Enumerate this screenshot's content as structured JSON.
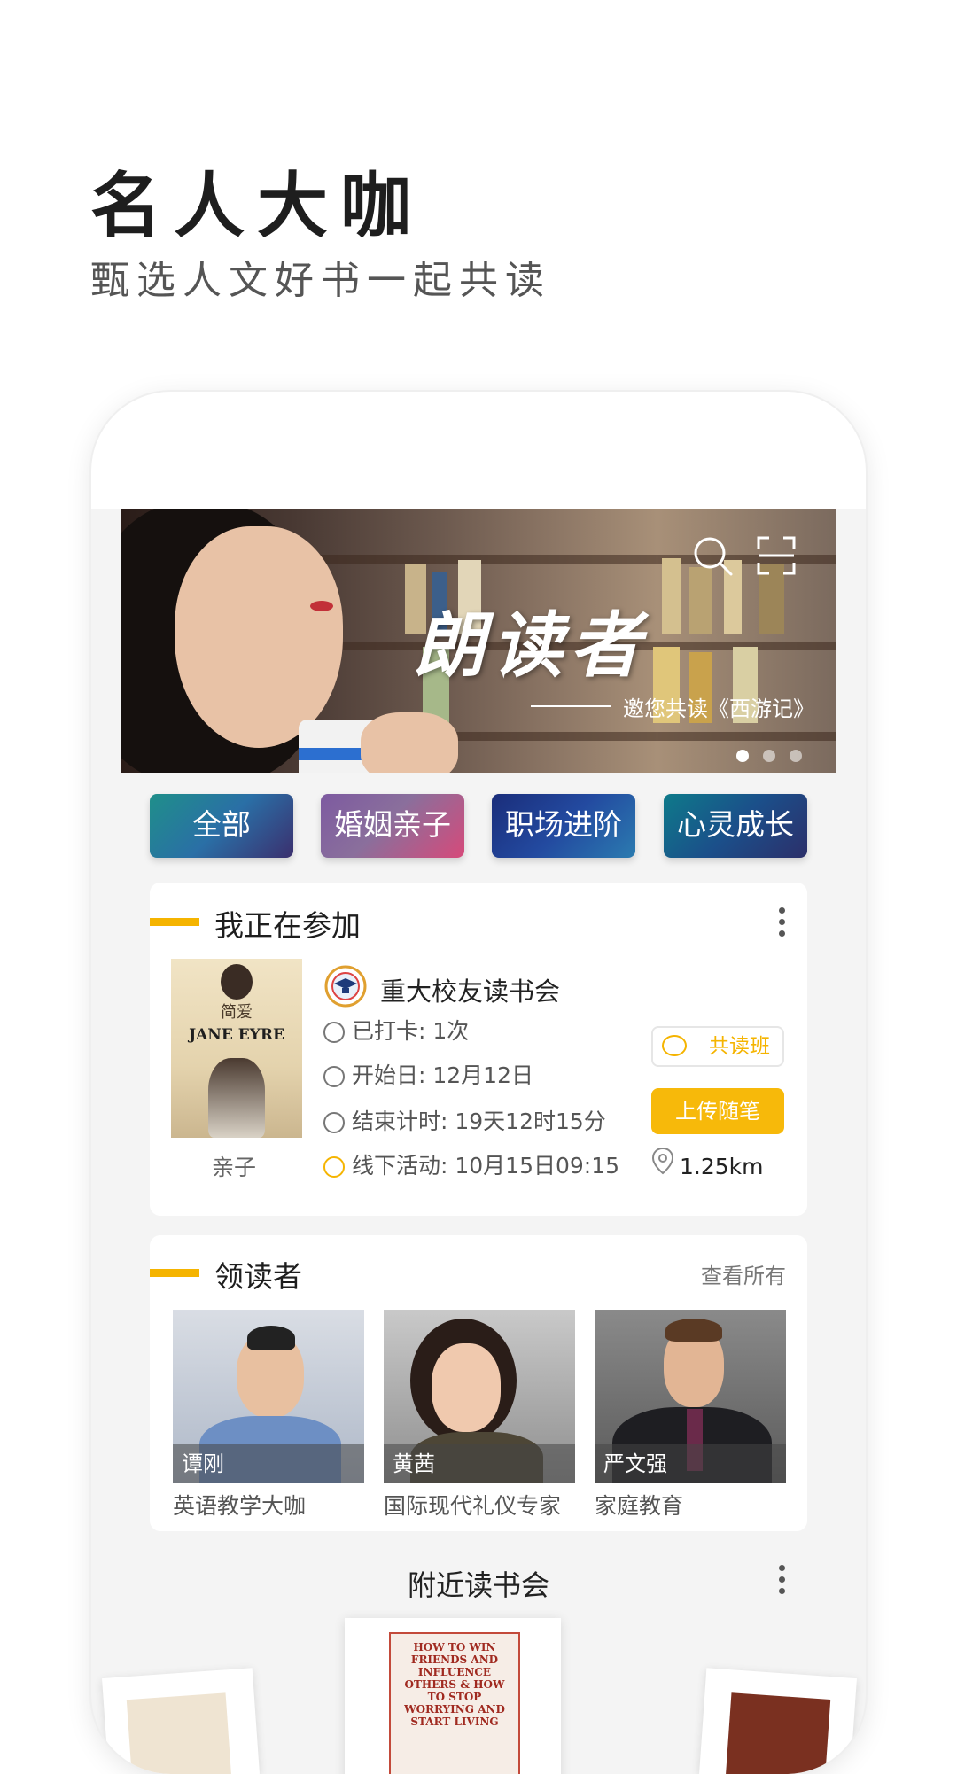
{
  "promo": {
    "title": "名人大咖",
    "subtitle": "甄选人文好书一起共读"
  },
  "banner": {
    "heading": "朗读者",
    "subtitle": "邀您共读《西游记》",
    "icons": [
      "search-icon",
      "scan-icon"
    ],
    "dots": 3,
    "active_dot": 0
  },
  "categories": [
    {
      "label": "全部"
    },
    {
      "label": "婚姻亲子"
    },
    {
      "label": "职场进阶"
    },
    {
      "label": "心灵成长"
    }
  ],
  "participating": {
    "title": "我正在参加",
    "book": {
      "cn_title": "简爱",
      "en_title": "JANE EYRE",
      "label": "亲子"
    },
    "club_name": "重大校友读书会",
    "club_badge_text": "Graduation",
    "checkin": "已打卡: 1次",
    "start": "开始日: 12月12日",
    "countdown": "结束计时: 19天12时15分",
    "offline": "线下活动: 10月15日09:15",
    "group_button": "共读班",
    "upload_button": "上传随笔",
    "distance": "1.25km"
  },
  "leaders": {
    "title": "领读者",
    "view_all": "查看所有",
    "items": [
      {
        "name": "谭刚",
        "role": "英语教学大咖"
      },
      {
        "name": "黄茜",
        "role": "国际现代礼仪专家"
      },
      {
        "name": "严文强",
        "role": "家庭教育"
      }
    ]
  },
  "nearby": {
    "title": "附近读书会",
    "center_book_text": "HOW TO WIN FRIENDS AND INFLUENCE OTHERS & HOW TO STOP WORRYING AND START LIVING"
  },
  "colors": {
    "accent": "#f5b400",
    "card_bg": "#ffffff",
    "phone_bg": "#f4f4f4"
  }
}
